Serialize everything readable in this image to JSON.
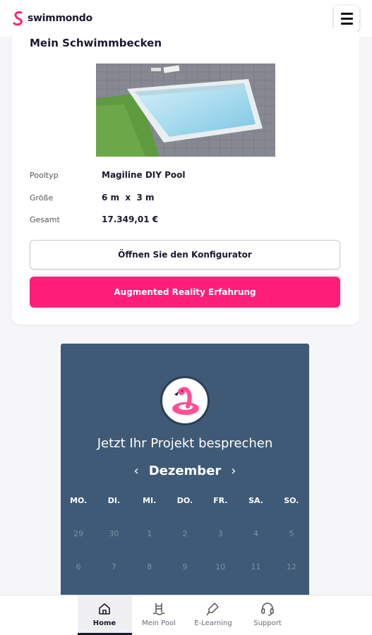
{
  "header": {
    "brand": "swimmondo",
    "menu_icon": "hamburger-menu-icon"
  },
  "pool": {
    "title": "Mein Schwimmbecken",
    "specs": [
      {
        "label": "Pooltyp",
        "value": "Magiline DIY Pool"
      },
      {
        "label": "Größe",
        "value": "6 m  x  3 m"
      },
      {
        "label": "Gesamt",
        "value": "17.349,01 €"
      }
    ],
    "configurator_button": "Öffnen Sie den Konfigurator",
    "ar_button": "Augmented Reality Erfahrung"
  },
  "calendar": {
    "heading": "Jetzt Ihr Projekt besprechen",
    "month": "Dezember",
    "prev_icon": "chevron-left-icon",
    "next_icon": "chevron-right-icon",
    "weekdays": [
      "MO.",
      "DI.",
      "MI.",
      "DO.",
      "FR.",
      "SA.",
      "SO."
    ],
    "weeks": [
      [
        "29",
        "30",
        "1",
        "2",
        "3",
        "4",
        "5"
      ],
      [
        "6",
        "7",
        "8",
        "9",
        "10",
        "11",
        "12"
      ]
    ]
  },
  "nav": {
    "items": [
      {
        "label": "Home",
        "icon": "home-icon",
        "active": true
      },
      {
        "label": "Mein Pool",
        "icon": "pool-ladder-icon",
        "active": false
      },
      {
        "label": "E-Learning",
        "icon": "learning-icon",
        "active": false
      },
      {
        "label": "Support",
        "icon": "headset-icon",
        "active": false
      }
    ]
  },
  "colors": {
    "accent": "#ff1f78",
    "calendar_bg": "#3f5a76",
    "text": "#1a1a2e"
  }
}
